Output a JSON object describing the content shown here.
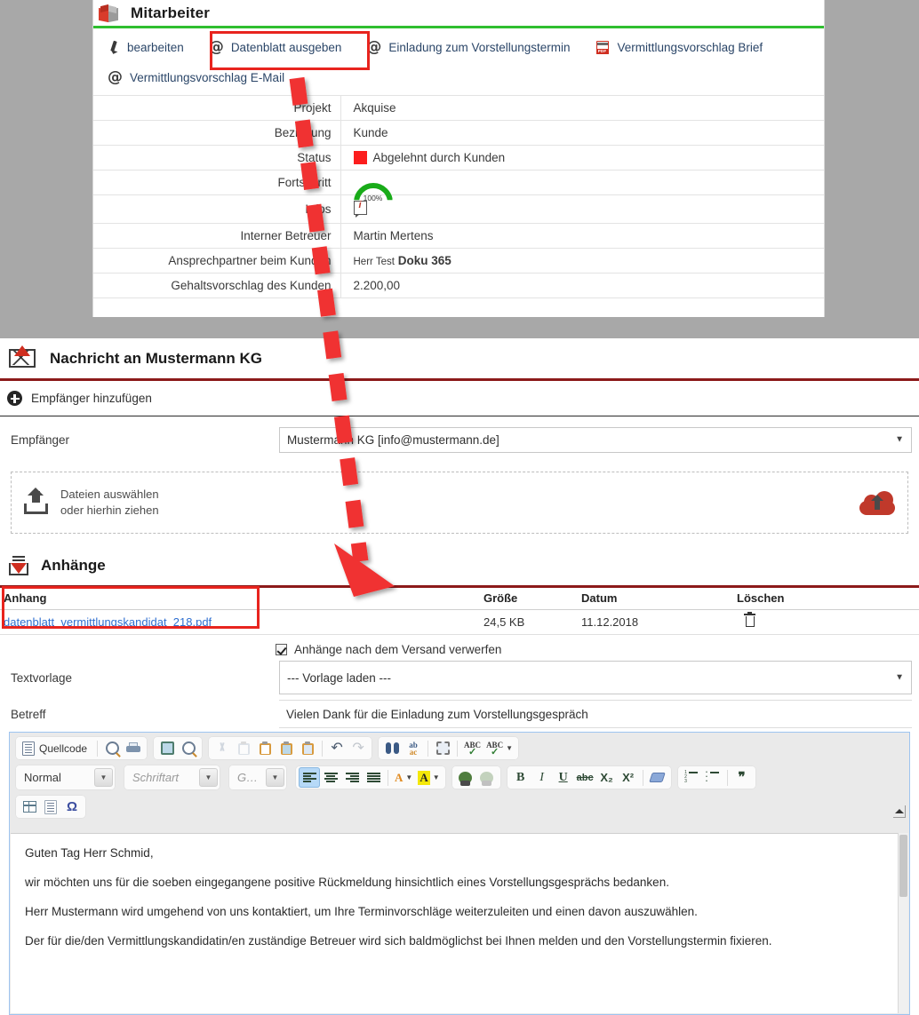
{
  "top_panel": {
    "icon": "box-icon",
    "title": "Mitarbeiter",
    "tabs": [
      {
        "icon": "pencil-icon",
        "label": "bearbeiten"
      },
      {
        "icon": "at-icon",
        "label": "Datenblatt ausgeben"
      },
      {
        "icon": "at-icon",
        "label": "Einladung zum Vorstellungstermin"
      },
      {
        "icon": "pdf-icon",
        "label": "Vermittlungsvorschlag Brief"
      },
      {
        "icon": "at-icon",
        "label": "Vermittlungsvorschlag E-Mail"
      }
    ],
    "details": [
      {
        "label": "Projekt",
        "value": "Akquise",
        "type": "text"
      },
      {
        "label": "Beziehung",
        "value": "Kunde",
        "type": "text"
      },
      {
        "label": "Status",
        "value": "Abgelehnt durch Kunden",
        "type": "status",
        "color": "#fc1e1e"
      },
      {
        "label": "Fortschritt",
        "value": "100%",
        "type": "gauge",
        "color": "#19ab19"
      },
      {
        "label": "Infos",
        "value": "",
        "type": "info"
      },
      {
        "label": "Interner Betreuer",
        "value": "Martin Mertens",
        "type": "text"
      },
      {
        "label": "Ansprechpartner beim Kunden",
        "value": "Herr Test Doku 365",
        "type": "person",
        "prefix": "Herr Test",
        "name": "Doku 365"
      },
      {
        "label": "Gehaltsvorschlag des Kunden",
        "value": "2.200,00",
        "type": "text"
      }
    ]
  },
  "message": {
    "icon": "envelope-icon",
    "title": "Nachricht an Mustermann KG",
    "add_recipient": "Empfänger hinzufügen",
    "recipient_label": "Empfänger",
    "recipient_value": "Mustermann KG [info@mustermann.de]",
    "dropzone_line1": "Dateien auswählen",
    "dropzone_line2": "oder hierhin ziehen",
    "dropzone_icon": "upload-icon",
    "cloud_icon": "cloud-upload-icon",
    "attachments_title": "Anhänge",
    "attachments_icon": "download-icon",
    "att_columns": [
      "Anhang",
      "Größe",
      "Datum",
      "Löschen"
    ],
    "att_rows": [
      {
        "name": "datenblatt_vermittlungskandidat_218.pdf",
        "size": "24,5 KB",
        "date": "11.12.2018",
        "delete_icon": "trash-icon"
      }
    ],
    "discard_checkbox_label": "Anhänge nach dem Versand verwerfen",
    "discard_checked": true,
    "template_label": "Textvorlage",
    "template_value": "--- Vorlage laden ---",
    "subject_label": "Betreff",
    "subject_value": "Vielen Dank für die Einladung zum Vorstellungsgespräch"
  },
  "editor": {
    "toolbar_row1": [
      {
        "name": "source-button",
        "label": "Quellcode",
        "icon": "source-icon"
      },
      {
        "name": "preview-button",
        "label": "",
        "icon": "preview-icon"
      },
      {
        "name": "print-button",
        "label": "",
        "icon": "print-icon"
      },
      {
        "name": "templates-button",
        "label": "",
        "icon": "templates-icon"
      },
      {
        "name": "document-properties-button",
        "label": "",
        "icon": "doc-properties-icon"
      },
      {
        "name": "cut-button",
        "label": "",
        "icon": "scissors-icon"
      },
      {
        "name": "copy-button",
        "label": "",
        "icon": "copy-icon"
      },
      {
        "name": "paste-button",
        "label": "",
        "icon": "paste-icon"
      },
      {
        "name": "paste-text-button",
        "label": "",
        "icon": "paste-text-icon"
      },
      {
        "name": "paste-word-button",
        "label": "",
        "icon": "paste-word-icon"
      },
      {
        "name": "undo-button",
        "label": "",
        "icon": "undo-icon"
      },
      {
        "name": "redo-button",
        "label": "",
        "icon": "redo-icon"
      },
      {
        "name": "find-button",
        "label": "",
        "icon": "binoculars-icon"
      },
      {
        "name": "replace-button",
        "label": "",
        "icon": "replace-icon"
      },
      {
        "name": "select-all-button",
        "label": "",
        "icon": "select-all-icon"
      },
      {
        "name": "spellcheck-button",
        "label": "",
        "icon": "spellcheck-icon"
      },
      {
        "name": "scayt-button",
        "label": "",
        "icon": "scayt-icon"
      }
    ],
    "format_select": "Normal",
    "font_select": "Schriftart",
    "size_select": "G…",
    "bold": "B",
    "italic": "I",
    "underline": "U",
    "strike": "abc",
    "subscript": "X₂",
    "superscript": "X²",
    "quote_glyph": "❞",
    "omega_glyph": "Ω",
    "body_paragraphs": [
      "Guten Tag Herr Schmid,",
      "wir möchten uns für die soeben eingegangene positive Rückmeldung  hinsichtlich eines Vorstellungsgesprächs bedanken.",
      "Herr Mustermann wird umgehend von uns kontaktiert, um Ihre Terminvorschläge weiterzuleiten und einen davon auszuwählen.",
      "Der für die/den Vermittlungskandidatin/en zuständige Betreuer wird sich baldmöglichst bei Ihnen melden und den Vorstellungstermin fixieren."
    ]
  },
  "annotations": {
    "highlight_color": "#e8241e",
    "boxes": [
      "datenblatt-ausgeben-tab",
      "anhang-column"
    ],
    "arrow": "red-dashed-arrow"
  }
}
